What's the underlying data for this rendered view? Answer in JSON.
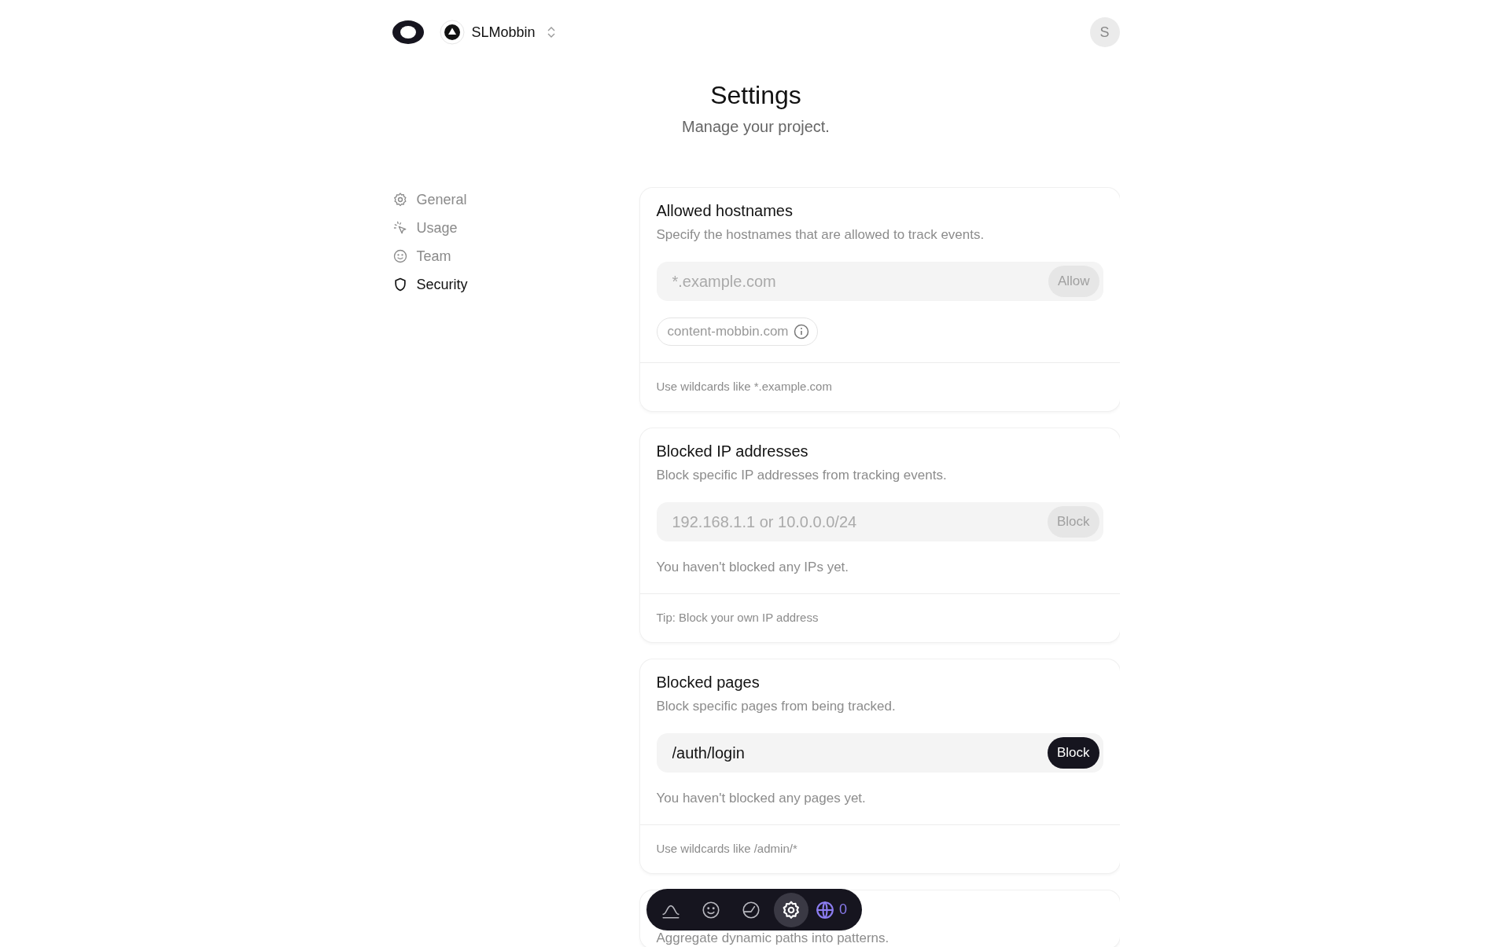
{
  "header": {
    "project": "SLMobbin",
    "avatar_initial": "S"
  },
  "page": {
    "title": "Settings",
    "subtitle": "Manage your project."
  },
  "sidebar": {
    "items": [
      {
        "label": "General",
        "selected": false
      },
      {
        "label": "Usage",
        "selected": false
      },
      {
        "label": "Team",
        "selected": false
      },
      {
        "label": "Security",
        "selected": true
      }
    ]
  },
  "cards": [
    {
      "title": "Allowed hostnames",
      "description": "Specify the hostnames that are allowed to track events.",
      "input": {
        "placeholder": "*.example.com"
      },
      "button": {
        "label": "Allow",
        "disabled": true
      },
      "tags": [
        "content-mobbin.com"
      ],
      "footer": "Use wildcards like *.example.com"
    },
    {
      "title": "Blocked IP addresses",
      "description": "Block specific IP addresses from tracking events.",
      "input": {
        "placeholder": "192.168.1.1 or 10.0.0.0/24"
      },
      "button": {
        "label": "Block",
        "disabled": true
      },
      "empty_message": "You haven't blocked any IPs yet.",
      "footer": "Tip: Block your own IP address"
    },
    {
      "title": "Blocked pages",
      "description": "Block specific pages from being tracked.",
      "input": {
        "value": "/auth/login"
      },
      "button": {
        "label": "Block",
        "disabled": false
      },
      "empty_message": "You haven't blocked any pages yet.",
      "footer": "Use wildcards like /admin/*"
    },
    {
      "description": "Aggregate dynamic paths into patterns."
    }
  ],
  "toolbar": {
    "items": [
      {
        "selected": false
      },
      {
        "selected": false
      },
      {
        "selected": false
      },
      {
        "selected": true
      },
      {
        "selected": false,
        "count": "0"
      }
    ]
  }
}
